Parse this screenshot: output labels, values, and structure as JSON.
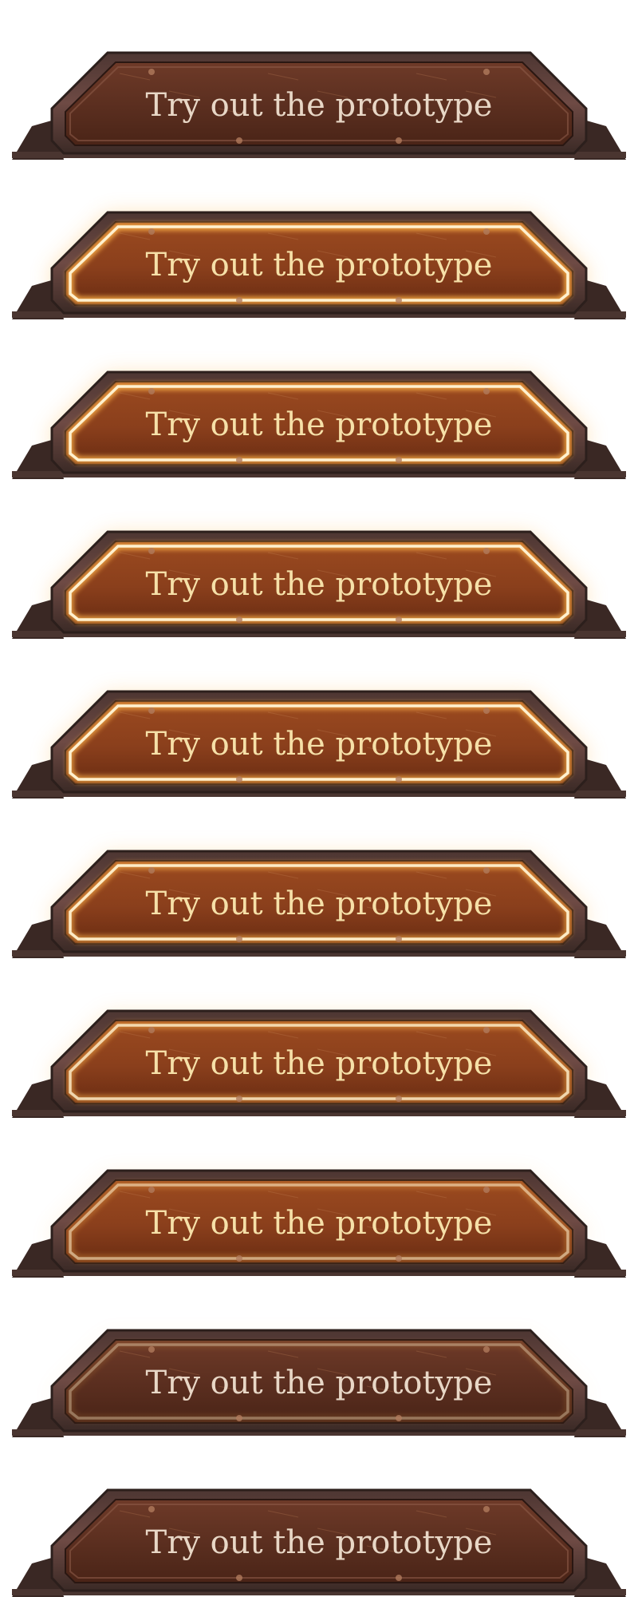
{
  "button": {
    "label": "Try out the prototype"
  },
  "frames": [
    {
      "state": "idle",
      "glow": 0.0
    },
    {
      "state": "hover-glow",
      "glow": 1.0
    },
    {
      "state": "hover-glow",
      "glow": 0.95
    },
    {
      "state": "hover-glow",
      "glow": 0.9
    },
    {
      "state": "hover-glow",
      "glow": 0.85
    },
    {
      "state": "hover-glow",
      "glow": 0.75
    },
    {
      "state": "hover-glow",
      "glow": 0.6
    },
    {
      "state": "hover-glow",
      "glow": 0.35
    },
    {
      "state": "hover-glow",
      "glow": 0.15
    },
    {
      "state": "idle",
      "glow": 0.0
    }
  ],
  "colors": {
    "frame_dark": "#3b2a26",
    "frame_mid": "#6e4a44",
    "panel_base": "#5a2e1f",
    "panel_warm": "#8a3f1c",
    "glow": "#ffb24a",
    "glow_core": "#fff1d0",
    "text_idle": "#e8d7c6",
    "text_glow": "#f6e0a8"
  }
}
